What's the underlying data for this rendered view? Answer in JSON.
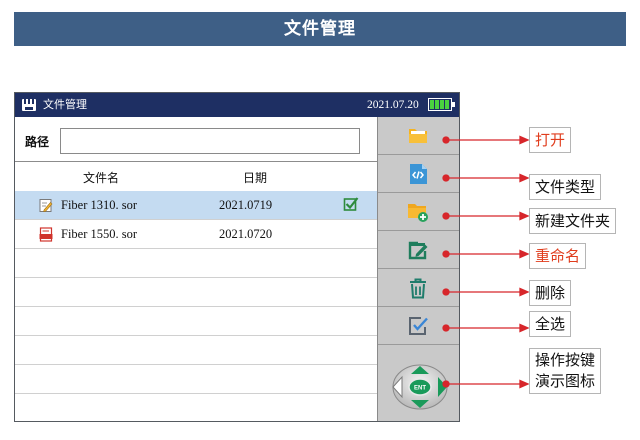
{
  "banner": {
    "title": "文件管理"
  },
  "device": {
    "title": "文件管理",
    "date": "2021.07.20",
    "battery_level": 1.0,
    "path": {
      "label": "路径",
      "value": "",
      "placeholder": ""
    },
    "columns": {
      "name": "文件名",
      "date": "日期"
    },
    "files": [
      {
        "name": "Fiber 1310. sor",
        "date": "2021.0719",
        "selected": true,
        "icon": "edit-file-icon"
      },
      {
        "name": "Fiber 1550. sor",
        "date": "2021.0720",
        "selected": false,
        "icon": "pdf-file-icon"
      }
    ],
    "side_buttons": [
      {
        "icon": "open-folder-icon"
      },
      {
        "icon": "code-file-icon"
      },
      {
        "icon": "new-folder-icon"
      },
      {
        "icon": "rename-icon"
      },
      {
        "icon": "trash-icon"
      },
      {
        "icon": "select-all-icon"
      },
      {
        "icon": "direction-pad-icon",
        "center": "ENT"
      }
    ]
  },
  "callouts": {
    "open": "打开",
    "file_type": "文件类型",
    "new_folder": "新建文件夹",
    "rename": "重命名",
    "delete": "删除",
    "select_all": "全选",
    "demo_line1": "操作按键",
    "demo_line2": "演示图标"
  },
  "colors": {
    "banner_bg": "#3e5f86",
    "titlebar_bg": "#1e2f63",
    "selected_row": "#c4dbf1",
    "side_panel": "#c9c9c9",
    "callout_line": "#d7262b",
    "callout_red_text": "#e03c1c",
    "battery_green": "#4ad13f",
    "nav_green": "#1a9a5a"
  }
}
